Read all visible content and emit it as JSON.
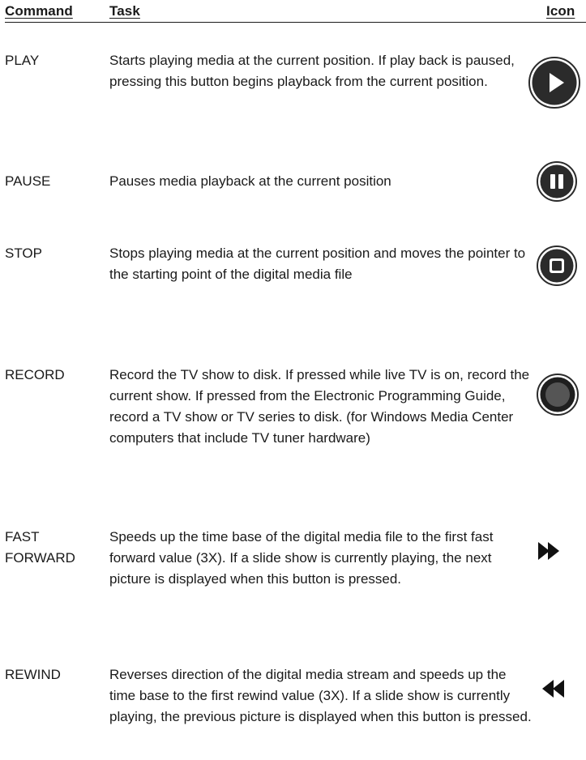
{
  "header": {
    "command": "Command",
    "task": "Task",
    "icon": "Icon"
  },
  "rows": [
    {
      "command_lines": [
        "PLAY"
      ],
      "task": "Starts playing media at the current position. If play back is paused, pressing this button begins playback from the current position.",
      "icon": "play-icon"
    },
    {
      "command_lines": [
        "PAUSE"
      ],
      "task": "Pauses media playback at the current position",
      "icon": "pause-icon"
    },
    {
      "command_lines": [
        "STOP"
      ],
      "task": "Stops playing media at the current position and moves the pointer to the starting point of the digital media file",
      "icon": "stop-icon"
    },
    {
      "command_lines": [
        "RECORD"
      ],
      "task": "Record the TV show to disk. If pressed while live TV is on, record the current show. If pressed from the Electronic Programming Guide, record a TV show or TV series to disk. (for Windows Media Center computers that include TV tuner hardware)",
      "icon": "record-icon"
    },
    {
      "command_lines": [
        "FAST",
        "FORWARD"
      ],
      "task": "Speeds up the time base of the digital media file to the first fast forward value (3X). If a slide show is currently playing, the next picture is displayed when this button is pressed.",
      "icon": "fast-forward-icon"
    },
    {
      "command_lines": [
        "REWIND"
      ],
      "task": "Reverses direction of the digital media stream and speeds up the time base to the first rewind value (3X). If a slide show is currently playing, the previous picture is displayed when this button is pressed.",
      "icon": "rewind-icon"
    }
  ],
  "colors": {
    "text": "#1a1a1a",
    "icon_dark": "#2b2b2b",
    "record_fill": "#555555"
  }
}
